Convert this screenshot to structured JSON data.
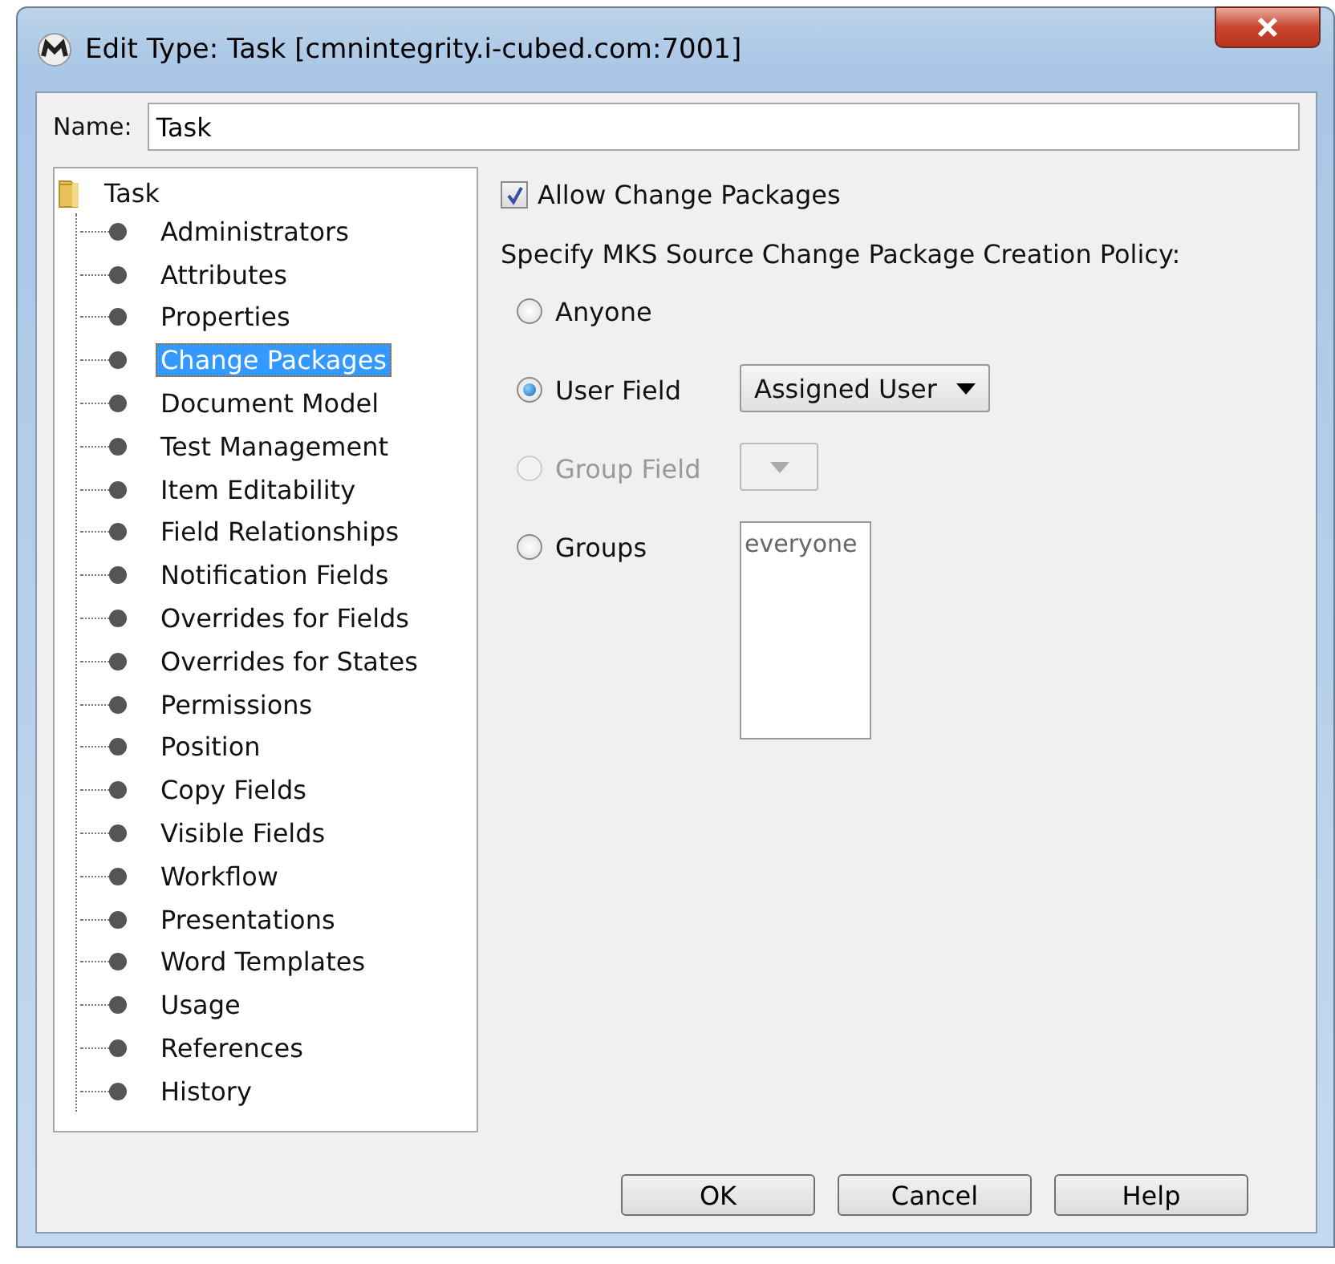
{
  "window": {
    "title": "Edit Type: Task [cmnintegrity.i-cubed.com:7001]"
  },
  "name_field": {
    "label": "Name:",
    "value": "Task"
  },
  "tree": {
    "label": "Task",
    "children": [
      {
        "label": "Administrators",
        "selected": false
      },
      {
        "label": "Attributes",
        "selected": false
      },
      {
        "label": "Properties",
        "selected": false
      },
      {
        "label": "Change Packages",
        "selected": true
      },
      {
        "label": "Document Model",
        "selected": false
      },
      {
        "label": "Test Management",
        "selected": false
      },
      {
        "label": "Item Editability",
        "selected": false
      },
      {
        "label": "Field Relationships",
        "selected": false
      },
      {
        "label": "Notification Fields",
        "selected": false
      },
      {
        "label": "Overrides for Fields",
        "selected": false
      },
      {
        "label": "Overrides for States",
        "selected": false
      },
      {
        "label": "Permissions",
        "selected": false
      },
      {
        "label": "Position",
        "selected": false
      },
      {
        "label": "Copy Fields",
        "selected": false
      },
      {
        "label": "Visible Fields",
        "selected": false
      },
      {
        "label": "Workflow",
        "selected": false
      },
      {
        "label": "Presentations",
        "selected": false
      },
      {
        "label": "Word Templates",
        "selected": false
      },
      {
        "label": "Usage",
        "selected": false
      },
      {
        "label": "References",
        "selected": false
      },
      {
        "label": "History",
        "selected": false
      }
    ]
  },
  "allow_change_packages": {
    "label": "Allow Change Packages",
    "checked": true
  },
  "policy": {
    "label": "Specify MKS Source Change Package Creation Policy:",
    "options": [
      {
        "label": "Anyone",
        "selected": false,
        "disabled": false
      },
      {
        "label": "User Field",
        "selected": true,
        "disabled": false,
        "kind": "dropdown",
        "value": "Assigned User"
      },
      {
        "label": "Group Field",
        "selected": false,
        "disabled": true,
        "kind": "dropdown"
      },
      {
        "label": "Groups",
        "selected": false,
        "disabled": false,
        "kind": "list",
        "items": [
          "everyone"
        ]
      }
    ]
  },
  "buttons": [
    "OK",
    "Cancel",
    "Help"
  ]
}
